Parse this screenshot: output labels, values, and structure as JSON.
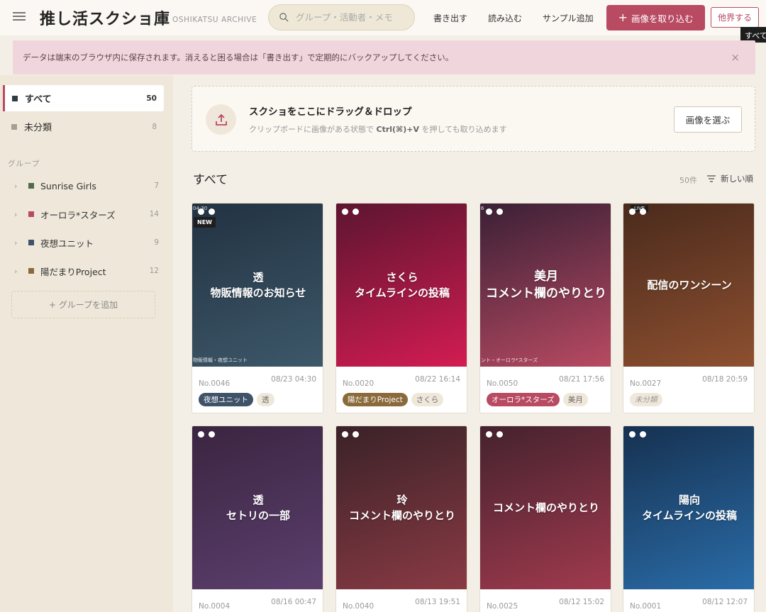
{
  "header": {
    "title": "推し活スクショ庫",
    "subtitle": "OSHIKATSU ARCHIVE",
    "search_placeholder": "グループ・活動者・メモ",
    "export_label": "書き出す",
    "import_file_label": "読み込む",
    "add_sample_label": "サンプル追加",
    "import_images_label": "画像を取り込む",
    "other_label": "他界する",
    "tooltip": "すべて"
  },
  "notice": {
    "text": "データは端末のブラウザ内に保存されます。消えると困る場合は「書き出す」で定期的にバックアップしてください。",
    "close": "×"
  },
  "sidebar": {
    "all": {
      "label": "すべて",
      "count": "50",
      "color": "#2f3b45"
    },
    "uncategorized": {
      "label": "未分類",
      "count": "8",
      "color": "#a89e8e"
    },
    "group_heading": "グループ",
    "groups": [
      {
        "label": "Sunrise Girls",
        "count": "7",
        "color": "#4f6b4a"
      },
      {
        "label": "オーロラ*スターズ",
        "count": "14",
        "color": "#b84a62"
      },
      {
        "label": "夜想ユニット",
        "count": "9",
        "color": "#3e5268"
      },
      {
        "label": "陽だまりProject",
        "count": "12",
        "color": "#8a6a3a"
      }
    ],
    "add_group": "+ グループを追加"
  },
  "dropzone": {
    "title": "スクショをここにドラッグ＆ドロップ",
    "sub_prefix": "クリップボードに画像がある状態で",
    "sub_key": "Ctrl(⌘)+V",
    "sub_suffix": "を押しても取り込めます",
    "button": "画像を選ぶ"
  },
  "main": {
    "section_title": "すべて",
    "count_label": "50件",
    "sort_label": "新しい順"
  },
  "cards": [
    {
      "no": "No.0046",
      "date": "08/23 04:30",
      "text": "透\n物販情報のお知らせ",
      "gradient": [
        "#223242",
        "#3d5869"
      ],
      "group": "夜想ユニット",
      "group_color": "#3e5268",
      "member": "透",
      "corner": "04:30",
      "new": "NEW",
      "footer": "物販情報・夜想ユニット"
    },
    {
      "no": "No.0020",
      "date": "08/22 16:14",
      "text": "さくら\nタイムラインの投稿",
      "gradient": [
        "#5c1530",
        "#d31c52"
      ],
      "group": "陽だまりProject",
      "group_color": "#8a6a3a",
      "member": "さくら"
    },
    {
      "no": "No.0050",
      "date": "08/21 17:56",
      "text": "美月\nコメント欄のやりとり",
      "gradient": [
        "#3a2036",
        "#b84a62"
      ],
      "group": "オーロラ*スターズ",
      "group_color": "#b84a62",
      "member": "美月",
      "corner": "6",
      "footer": "ント・オーロラ*スターズ"
    },
    {
      "no": "No.0027",
      "date": "08/18 20:59",
      "text": "配信のワンシーン",
      "gradient": [
        "#4a2a1c",
        "#8e5030"
      ],
      "uncategorized": "未分類",
      "live": "LIVE"
    },
    {
      "no": "No.0004",
      "date": "08/16 00:47",
      "text": "透\nセトリの一部",
      "gradient": [
        "#3a2540",
        "#5c3f6e"
      ]
    },
    {
      "no": "No.0040",
      "date": "08/13 19:51",
      "text": "玲\nコメント欄のやりとり",
      "gradient": [
        "#3a2228",
        "#8a3a44"
      ]
    },
    {
      "no": "No.0025",
      "date": "08/12 15:02",
      "text": "コメント欄のやりとり",
      "gradient": [
        "#45222e",
        "#a03a4e"
      ]
    },
    {
      "no": "No.0001",
      "date": "08/12 12:07",
      "text": "陽向\nタイムラインの投稿",
      "gradient": [
        "#163150",
        "#2a6ca8"
      ]
    }
  ]
}
